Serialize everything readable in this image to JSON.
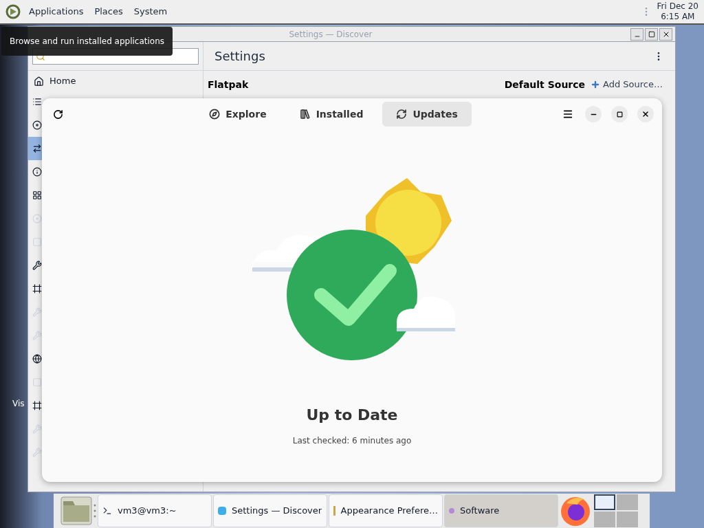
{
  "top_panel": {
    "menus": [
      "Applications",
      "Places",
      "System"
    ],
    "clock": {
      "date": "Fri Dec 20",
      "time": "6:15 AM"
    }
  },
  "tooltip": "Browse and run installed applications",
  "desktop_icon": {
    "label": "Vis"
  },
  "back_window": {
    "title": "Settings — Discover",
    "heading": "Settings",
    "sidebar": {
      "items": [
        {
          "label": "Home",
          "selected": false
        }
      ],
      "icon_rows": [
        {
          "kind": "list",
          "selected": false,
          "disabled": false
        },
        {
          "kind": "disc",
          "selected": false,
          "disabled": false
        },
        {
          "kind": "arrows",
          "selected": true,
          "disabled": false
        },
        {
          "kind": "info",
          "selected": false,
          "disabled": false
        },
        {
          "kind": "grid",
          "selected": false,
          "disabled": false
        },
        {
          "kind": "disc",
          "selected": false,
          "disabled": true
        },
        {
          "kind": "square",
          "selected": false,
          "disabled": true
        },
        {
          "kind": "wrench",
          "selected": false,
          "disabled": false
        },
        {
          "kind": "frame",
          "selected": false,
          "disabled": false
        },
        {
          "kind": "wrench",
          "selected": false,
          "disabled": true
        },
        {
          "kind": "wrench",
          "selected": false,
          "disabled": true
        },
        {
          "kind": "globe",
          "selected": false,
          "disabled": false
        },
        {
          "kind": "square",
          "selected": false,
          "disabled": true
        },
        {
          "kind": "frame",
          "selected": false,
          "disabled": false
        },
        {
          "kind": "wrench",
          "selected": false,
          "disabled": true
        },
        {
          "kind": "wrench",
          "selected": false,
          "disabled": true
        }
      ]
    },
    "section": "Flatpak",
    "default_source": "Default Source",
    "add_source": "Add Source…"
  },
  "front_window": {
    "tabs": [
      {
        "label": "Explore",
        "selected": false
      },
      {
        "label": "Installed",
        "selected": false
      },
      {
        "label": "Updates",
        "selected": true
      }
    ],
    "status_title": "Up to Date",
    "status_subtitle": "Last checked: 6 minutes ago"
  },
  "taskbar": {
    "tasks": [
      {
        "label": "vm3@vm3:~",
        "selected": false
      },
      {
        "label": "Settings — Discover",
        "selected": false
      },
      {
        "label": "Appearance Prefere…",
        "selected": false
      },
      {
        "label": "Software",
        "selected": true
      }
    ],
    "workspaces": [
      {
        "selected": true
      },
      {
        "selected": false
      },
      {
        "selected": false
      },
      {
        "selected": false
      }
    ]
  }
}
